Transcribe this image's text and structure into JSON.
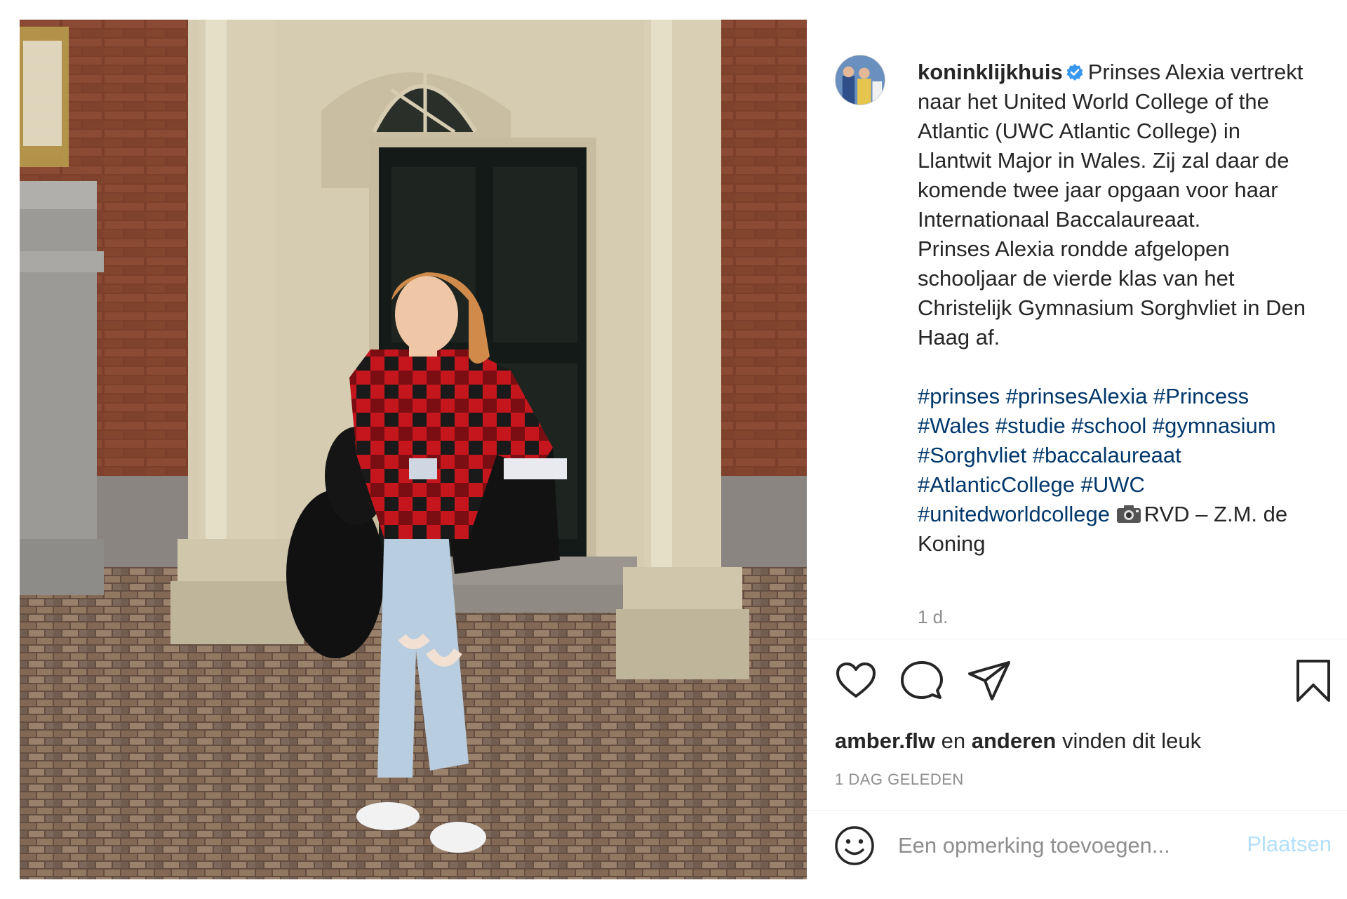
{
  "post": {
    "username": "koninklijkhuis",
    "verified": true,
    "caption_text": "Prinses Alexia vertrekt naar het United World College of the Atlantic (UWC Atlantic College) in Llantwit Major in Wales. Zij zal daar de komende twee jaar opgaan voor haar Internationaal Baccalaureaat.\nPrinses Alexia rondde afgelopen schooljaar de vierde klas van het Christelijk Gymnasium Sorghvliet in Den Haag af.",
    "hashtags": "#prinses #prinsesAlexia #Princess #Wales #studie #school #gymnasium #Sorghvliet #baccalaureaat #AtlanticCollege #UWC #unitedworldcollege",
    "photo_credit": "RVD – Z.M. de Koning",
    "time_short": "1 d."
  },
  "likes": {
    "user": "amber.flw",
    "connector": "en",
    "others": "anderen",
    "suffix": "vinden dit leuk"
  },
  "posted_ago": "1 DAG GELEDEN",
  "comment": {
    "placeholder": "Een opmerking toevoegen...",
    "post_label": "Plaatsen"
  },
  "icons": {
    "like": "heart-icon",
    "comment": "comment-bubble-icon",
    "share": "paper-plane-icon",
    "save": "bookmark-icon",
    "emoji": "smiley-icon",
    "verified": "verified-badge-icon",
    "camera": "camera-icon"
  },
  "colors": {
    "text": "#262626",
    "secondary": "#8e8e8e",
    "hashtag": "#00376b",
    "verified": "#3897f0",
    "post_disabled": "#b2dffc",
    "divider": "#efefef"
  }
}
